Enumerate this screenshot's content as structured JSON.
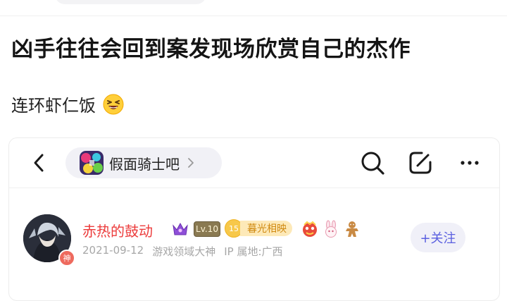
{
  "post": {
    "title": "凶手往往会回到案发现场欣赏自己的杰作",
    "body": "连环虾仁饭",
    "emoji": "grinning-squinting-face"
  },
  "card": {
    "nav": {
      "forum_name": "假面骑士吧",
      "icons": [
        "back-chevron-icon",
        "search-icon",
        "edit-icon",
        "more-icon"
      ]
    },
    "user": {
      "name": "赤热的鼓动",
      "level": "Lv.10",
      "medal_number": "15",
      "medal_title": "暮光相映",
      "god_badge": "神",
      "date": "2021-09-12",
      "tag": "游戏领域大神",
      "ip": "IP 属地:广西"
    },
    "follow_label": "+关注"
  },
  "colors": {
    "username": "#ec3c3c",
    "follow_text": "#5a5fe0",
    "meta_text": "#a7a7a7"
  }
}
